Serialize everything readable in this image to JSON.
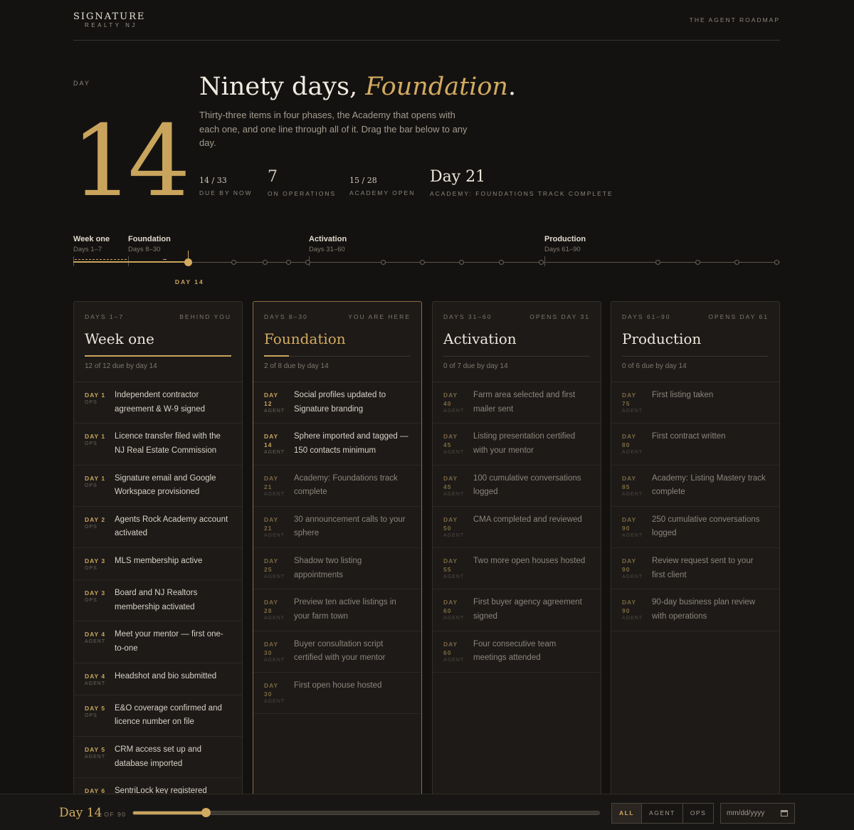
{
  "brand": {
    "name": "SIGNATURE",
    "sub": "REALTY NJ"
  },
  "header": {
    "link": "THE AGENT ROADMAP"
  },
  "hero": {
    "day_label": "DAY",
    "day": "14",
    "title_prefix": "Ninety days, ",
    "title_phase": "Foundation",
    "title_suffix": ".",
    "description": "Thirty-three items in four phases, the Academy that opens with each one, and one line through all of it. Drag the bar below to any day."
  },
  "stats": [
    {
      "value": "14 / 33",
      "label": "DUE BY NOW"
    },
    {
      "value": "7",
      "label": "ON OPERATIONS"
    },
    {
      "value": "15 / 28",
      "label": "ACADEMY OPEN"
    },
    {
      "value": "Day 21",
      "label": "ACADEMY: FOUNDATIONS TRACK COMPLETE"
    }
  ],
  "timeline": {
    "current_day": 14,
    "total_days": 90,
    "day_label": "DAY 14",
    "phases": [
      {
        "name": "Week one",
        "days": "Days 1–7"
      },
      {
        "name": "Foundation",
        "days": "Days 8–30"
      },
      {
        "name": "Activation",
        "days": "Days 31–60"
      },
      {
        "name": "Production",
        "days": "Days 61–90"
      }
    ]
  },
  "columns": [
    {
      "range": "DAYS 1–7",
      "status": "BEHIND YOU",
      "title": "Week one",
      "due": "12 of 12 due by day 14",
      "progress": 1.0,
      "active": false,
      "items": [
        {
          "day": "DAY 1",
          "owner": "OPS",
          "text": "Independent contractor agreement & W-9 signed"
        },
        {
          "day": "DAY 1",
          "owner": "OPS",
          "text": "Licence transfer filed with the NJ Real Estate Commission"
        },
        {
          "day": "DAY 1",
          "owner": "OPS",
          "text": "Signature email and Google Workspace provisioned"
        },
        {
          "day": "DAY 2",
          "owner": "OPS",
          "text": "Agents Rock Academy account activated"
        },
        {
          "day": "DAY 3",
          "owner": "OPS",
          "text": "MLS membership active"
        },
        {
          "day": "DAY 3",
          "owner": "OPS",
          "text": "Board and NJ Realtors membership activated"
        },
        {
          "day": "DAY 4",
          "owner": "AGENT",
          "text": "Meet your mentor — first one-to-one"
        },
        {
          "day": "DAY 4",
          "owner": "AGENT",
          "text": "Headshot and bio submitted"
        },
        {
          "day": "DAY 5",
          "owner": "OPS",
          "text": "E&O coverage confirmed and licence number on file"
        },
        {
          "day": "DAY 5",
          "owner": "AGENT",
          "text": "CRM access set up and database imported"
        },
        {
          "day": "DAY 6",
          "owner": "",
          "text": "SentriLock key registered"
        }
      ]
    },
    {
      "range": "DAYS 8–30",
      "status": "YOU ARE HERE",
      "title": "Foundation",
      "due": "2 of 8 due by day 14",
      "progress": 0.25,
      "active": true,
      "items": [
        {
          "day": "DAY 12",
          "owner": "AGENT",
          "text": "Social profiles updated to Signature branding",
          "future": false
        },
        {
          "day": "DAY 14",
          "owner": "AGENT",
          "text": "Sphere imported and tagged — 150 contacts minimum",
          "future": false
        },
        {
          "day": "DAY 21",
          "owner": "AGENT",
          "text": "Academy: Foundations track complete",
          "future": true
        },
        {
          "day": "DAY 21",
          "owner": "AGENT",
          "text": "30 announcement calls to your sphere",
          "future": true
        },
        {
          "day": "DAY 25",
          "owner": "AGENT",
          "text": "Shadow two listing appointments",
          "future": true
        },
        {
          "day": "DAY 28",
          "owner": "AGENT",
          "text": "Preview ten active listings in your farm town",
          "future": true
        },
        {
          "day": "DAY 30",
          "owner": "AGENT",
          "text": "Buyer consultation script certified with your mentor",
          "future": true
        },
        {
          "day": "DAY 30",
          "owner": "AGENT",
          "text": "First open house hosted",
          "future": true
        }
      ]
    },
    {
      "range": "DAYS 31–60",
      "status": "OPENS DAY 31",
      "title": "Activation",
      "due": "0 of 7 due by day 14",
      "progress": 0,
      "active": false,
      "items": [
        {
          "day": "DAY 40",
          "owner": "AGENT",
          "text": "Farm area selected and first mailer sent",
          "future": true
        },
        {
          "day": "DAY 45",
          "owner": "AGENT",
          "text": "Listing presentation certified with your mentor",
          "future": true
        },
        {
          "day": "DAY 45",
          "owner": "AGENT",
          "text": "100 cumulative conversations logged",
          "future": true
        },
        {
          "day": "DAY 50",
          "owner": "AGENT",
          "text": "CMA completed and reviewed",
          "future": true
        },
        {
          "day": "DAY 55",
          "owner": "AGENT",
          "text": "Two more open houses hosted",
          "future": true
        },
        {
          "day": "DAY 60",
          "owner": "AGENT",
          "text": "First buyer agency agreement signed",
          "future": true
        },
        {
          "day": "DAY 60",
          "owner": "AGENT",
          "text": "Four consecutive team meetings attended",
          "future": true
        }
      ]
    },
    {
      "range": "DAYS 61–90",
      "status": "OPENS DAY 61",
      "title": "Production",
      "due": "0 of 6 due by day 14",
      "progress": 0,
      "active": false,
      "items": [
        {
          "day": "DAY 75",
          "owner": "AGENT",
          "text": "First listing taken",
          "future": true
        },
        {
          "day": "DAY 80",
          "owner": "AGENT",
          "text": "First contract written",
          "future": true
        },
        {
          "day": "DAY 85",
          "owner": "AGENT",
          "text": "Academy: Listing Mastery track complete",
          "future": true
        },
        {
          "day": "DAY 90",
          "owner": "AGENT",
          "text": "250 cumulative conversations logged",
          "future": true
        },
        {
          "day": "DAY 90",
          "owner": "AGENT",
          "text": "Review request sent to your first client",
          "future": true
        },
        {
          "day": "DAY 90",
          "owner": "AGENT",
          "text": "90-day business plan review with operations",
          "future": true
        }
      ]
    }
  ],
  "bottom": {
    "day": "Day 14",
    "of": "OF 90",
    "filters": [
      "ALL",
      "AGENT",
      "OPS"
    ],
    "active_filter": "ALL",
    "date_placeholder": "mm/dd/yyyy"
  },
  "colors": {
    "accent": "#c9a45c",
    "background": "#141211",
    "card": "#1d1a18"
  }
}
